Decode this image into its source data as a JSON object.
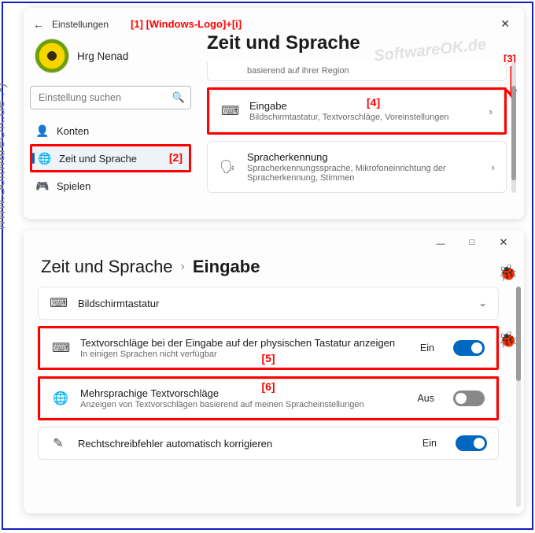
{
  "annotations": {
    "a1": "[1] [Windows-Logo]+[i]",
    "a2": "[2]",
    "a3": "[3]",
    "a4": "[4]",
    "a5": "[5]",
    "a6": "[6]"
  },
  "watermark_vertical": "www.SoftwareOK.de :-)",
  "watermark_diag": "SoftwareOK.de",
  "win1": {
    "back": "←",
    "header_label": "Einstellungen",
    "username": "Hrg Nenad",
    "search_placeholder": "Einstellung suchen",
    "nav": {
      "accounts": "Konten",
      "timelang": "Zeit und Sprache",
      "gaming": "Spielen"
    },
    "page_title": "Zeit und Sprache",
    "card0_sub": "basierend auf ihrer Region",
    "card_input": {
      "title": "Eingabe",
      "sub": "Bildschirmtastatur, Textvorschläge, Voreinstellungen"
    },
    "card_speech": {
      "title": "Spracherkennung",
      "sub": "Spracherkennungssprache, Mikrofoneinrichtung der Spracherkennung, Stimmen"
    }
  },
  "win2": {
    "crumb_parent": "Zeit und Sprache",
    "crumb_current": "Eingabe",
    "row_osk": {
      "title": "Bildschirmtastatur"
    },
    "row_suggest": {
      "title": "Textvorschläge bei der Eingabe auf der physischen Tastatur anzeigen",
      "sub": "In einigen Sprachen nicht verfügbar",
      "state": "Ein"
    },
    "row_multi": {
      "title": "Mehrsprachige Textvorschläge",
      "sub": "Anzeigen von Textvorschlägen basierend auf meinen Spracheinstellungen",
      "state": "Aus"
    },
    "row_spell": {
      "title": "Rechtschreibfehler automatisch korrigieren",
      "state": "Ein"
    }
  }
}
